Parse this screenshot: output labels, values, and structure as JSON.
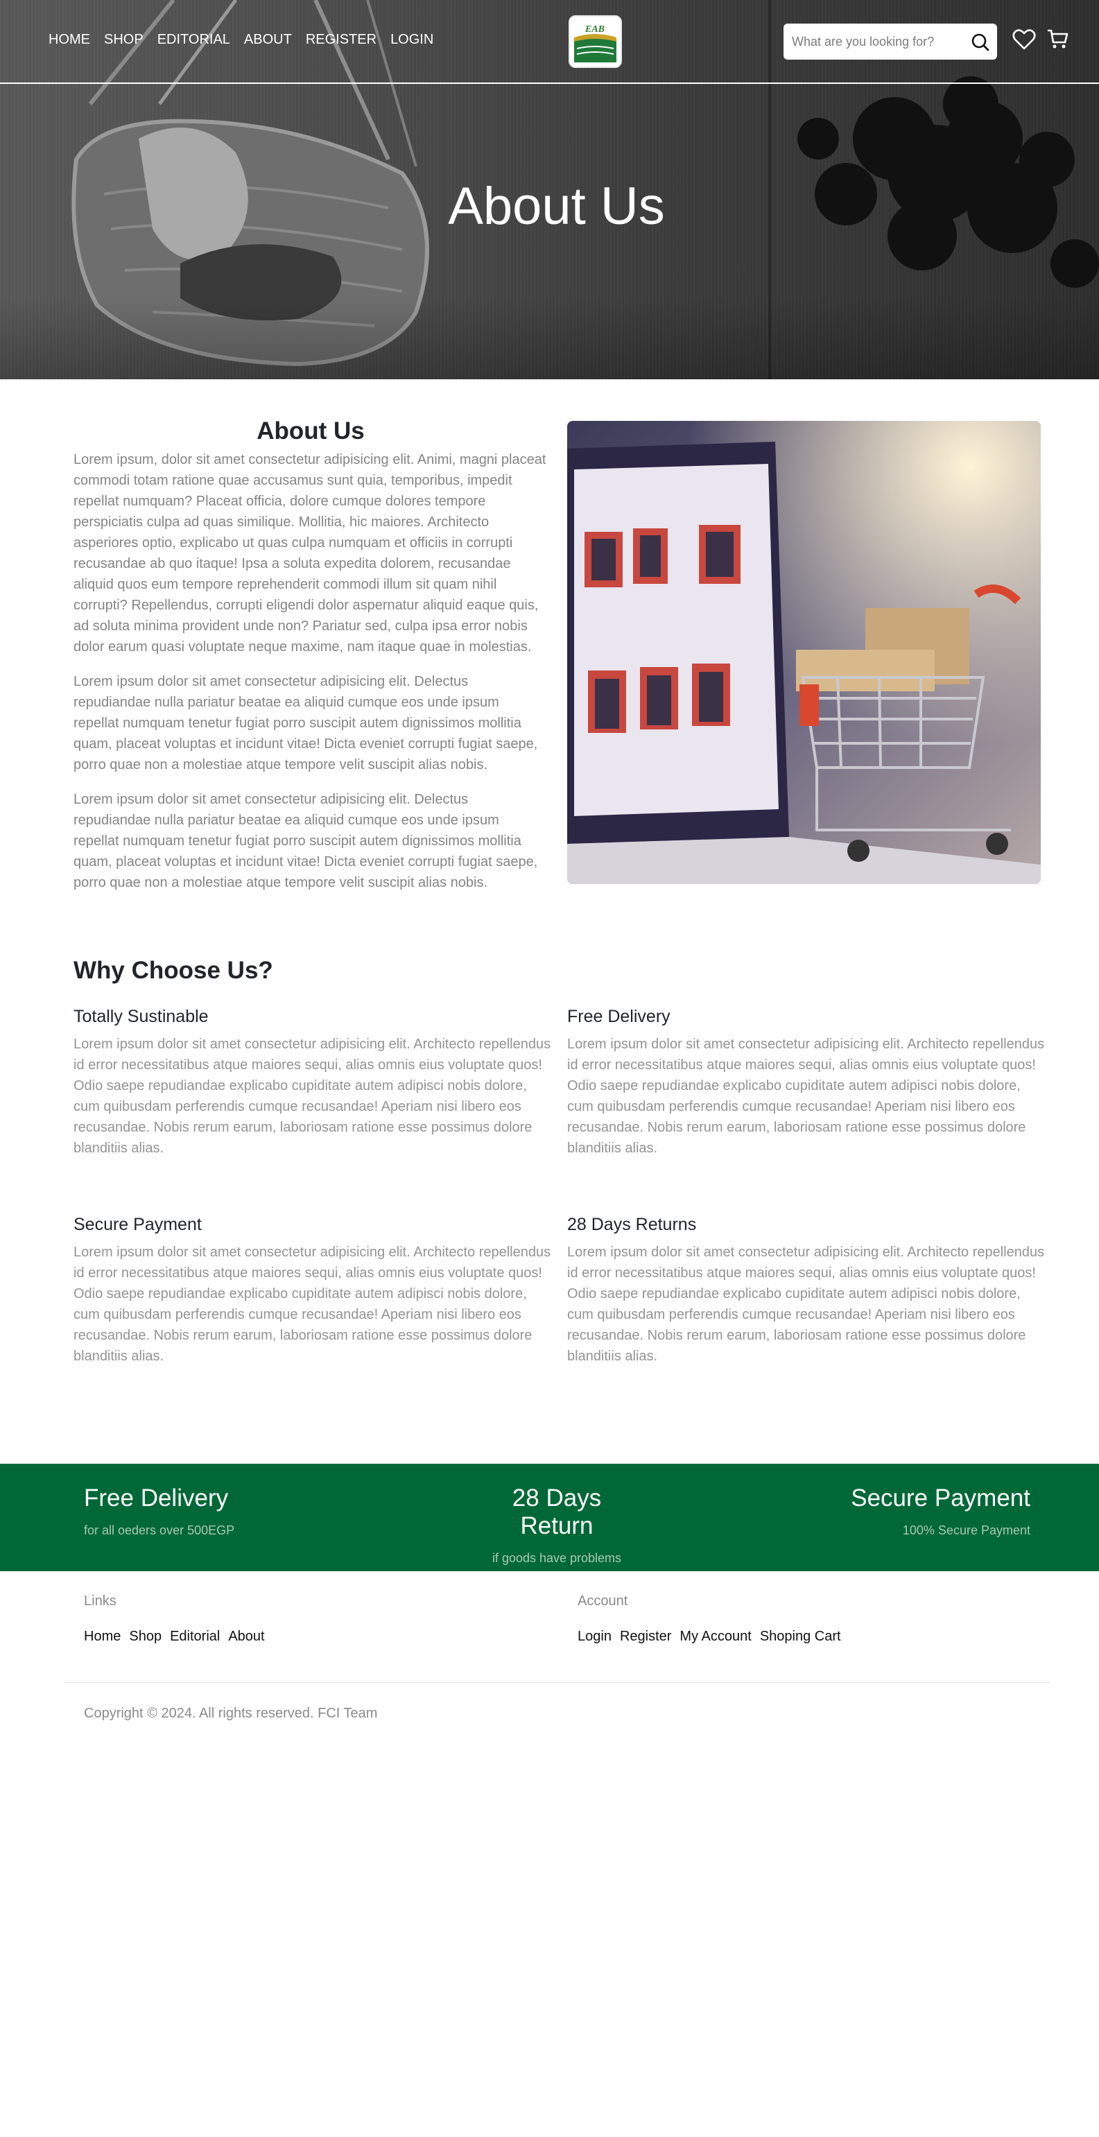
{
  "nav": {
    "links": [
      "HOME",
      "SHOP",
      "EDITORIAL",
      "ABOUT",
      "REGISTER",
      "LOGIN"
    ],
    "logo_text": "EAB",
    "search_placeholder": "What are you looking for?",
    "icons": [
      "search-icon",
      "heart-icon",
      "cart-icon"
    ]
  },
  "hero": {
    "title": "About Us"
  },
  "about": {
    "title": "About Us",
    "paragraphs": [
      "Lorem ipsum, dolor sit amet consectetur adipisicing elit. Animi, magni placeat commodi totam ratione quae accusamus sunt quia, temporibus, impedit repellat numquam? Placeat officia, dolore cumque dolores tempore perspiciatis culpa ad quas similique. Mollitia, hic maiores. Architecto asperiores optio, explicabo ut quas culpa numquam et officiis in corrupti recusandae ab quo itaque! Ipsa a soluta expedita dolorem, recusandae aliquid quos eum tempore reprehenderit commodi illum sit quam nihil corrupti? Repellendus, corrupti eligendi dolor aspernatur aliquid eaque quis, ad soluta minima provident unde non? Pariatur sed, culpa ipsa error nobis dolor earum quasi voluptate neque maxime, nam itaque quae in molestias.",
      "Lorem ipsum dolor sit amet consectetur adipisicing elit. Delectus repudiandae nulla pariatur beatae ea aliquid cumque eos unde ipsum repellat numquam tenetur fugiat porro suscipit autem dignissimos mollitia quam, placeat voluptas et incidunt vitae! Dicta eveniet corrupti fugiat saepe, porro quae non a molestiae atque tempore velit suscipit alias nobis.",
      "Lorem ipsum dolor sit amet consectetur adipisicing elit. Delectus repudiandae nulla pariatur beatae ea aliquid cumque eos unde ipsum repellat numquam tenetur fugiat porro suscipit autem dignissimos mollitia quam, placeat voluptas et incidunt vitae! Dicta eveniet corrupti fugiat saepe, porro quae non a molestiae atque tempore velit suscipit alias nobis."
    ]
  },
  "why": {
    "title": "Why Choose Us?",
    "features": [
      {
        "title": "Totally Sustinable",
        "text": "Lorem ipsum dolor sit amet consectetur adipisicing elit. Architecto repellendus id error necessitatibus atque maiores sequi, alias omnis eius voluptate quos! Odio saepe repudiandae explicabo cupiditate autem adipisci nobis dolore, cum quibusdam perferendis cumque recusandae! Aperiam nisi libero eos recusandae. Nobis rerum earum, laboriosam ratione esse possimus dolore blanditiis alias."
      },
      {
        "title": "Free Delivery",
        "text": "Lorem ipsum dolor sit amet consectetur adipisicing elit. Architecto repellendus id error necessitatibus atque maiores sequi, alias omnis eius voluptate quos! Odio saepe repudiandae explicabo cupiditate autem adipisci nobis dolore, cum quibusdam perferendis cumque recusandae! Aperiam nisi libero eos recusandae. Nobis rerum earum, laboriosam ratione esse possimus dolore blanditiis alias."
      },
      {
        "title": "Secure Payment",
        "text": "Lorem ipsum dolor sit amet consectetur adipisicing elit. Architecto repellendus id error necessitatibus atque maiores sequi, alias omnis eius voluptate quos! Odio saepe repudiandae explicabo cupiditate autem adipisci nobis dolore, cum quibusdam perferendis cumque recusandae! Aperiam nisi libero eos recusandae. Nobis rerum earum, laboriosam ratione esse possimus dolore blanditiis alias."
      },
      {
        "title": "28 Days Returns",
        "text": "Lorem ipsum dolor sit amet consectetur adipisicing elit. Architecto repellendus id error necessitatibus atque maiores sequi, alias omnis eius voluptate quos! Odio saepe repudiandae explicabo cupiditate autem adipisci nobis dolore, cum quibusdam perferendis cumque recusandae! Aperiam nisi libero eos recusandae. Nobis rerum earum, laboriosam ratione esse possimus dolore blanditiis alias."
      }
    ]
  },
  "band": {
    "color": "#006837",
    "items": [
      {
        "title": "Free Delivery",
        "sub": "for all oeders over 500EGP"
      },
      {
        "title": "28 Days Return",
        "sub": "if goods have problems"
      },
      {
        "title": "Secure Payment",
        "sub": "100% Secure Payment"
      }
    ]
  },
  "footer": {
    "links_title": "Links",
    "links": [
      "Home",
      "Shop",
      "Editorial",
      "About"
    ],
    "account_title": "Account",
    "account": [
      "Login",
      "Register",
      "My Account",
      "Shoping Cart"
    ],
    "copyright": "Copyright © 2024. All rights reserved. FCI Team"
  }
}
